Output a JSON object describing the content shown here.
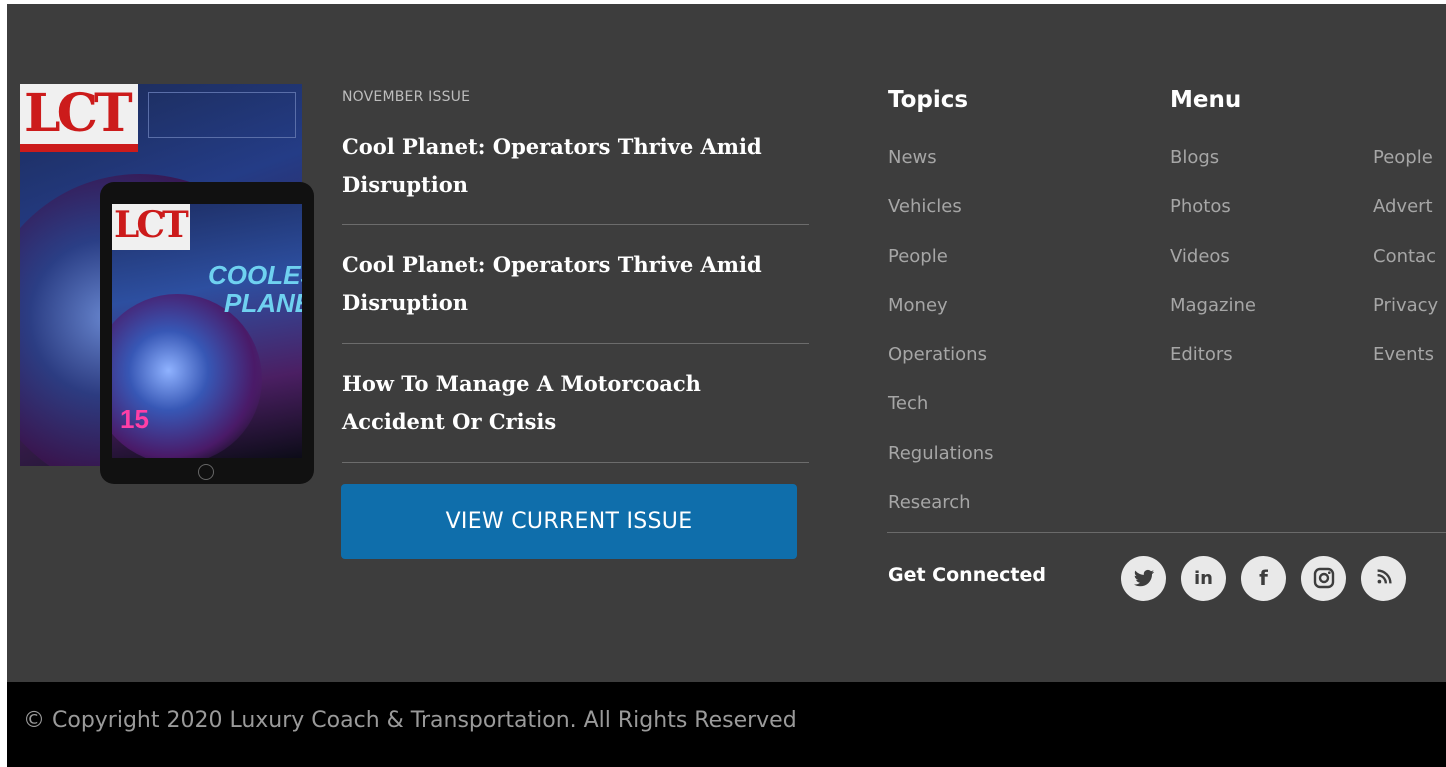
{
  "issue": {
    "label": "NOVEMBER ISSUE",
    "cover_logo": "LCT",
    "cover_headline_1": "COOLEST",
    "cover_headline_2": "PLANET",
    "cover_number": "15",
    "articles": [
      {
        "title": "Cool Planet: Operators Thrive Amid Disruption"
      },
      {
        "title": "Cool Planet: Operators Thrive Amid Disruption"
      },
      {
        "title": "How To Manage A Motorcoach Accident Or Crisis"
      }
    ],
    "view_button": "VIEW CURRENT ISSUE"
  },
  "topics": {
    "title": "Topics",
    "items": [
      "News",
      "Vehicles",
      "People",
      "Money",
      "Operations",
      "Tech",
      "Regulations",
      "Research"
    ]
  },
  "menu": {
    "title": "Menu",
    "col1": [
      "Blogs",
      "Photos",
      "Videos",
      "Magazine",
      "Editors"
    ],
    "col2": [
      "People",
      "Advert",
      "Contac",
      "Privacy",
      "Events"
    ]
  },
  "connect": {
    "title": "Get Connected",
    "icons": [
      "twitter-icon",
      "linkedin-icon",
      "facebook-icon",
      "instagram-icon",
      "rss-icon"
    ],
    "linkedin_glyph": "in",
    "facebook_glyph": "f"
  },
  "footer": {
    "copyright": "© Copyright 2020 Luxury Coach & Transportation. All Rights Reserved"
  },
  "colors": {
    "background": "#3d3d3d",
    "bottom_bar": "#000000",
    "button": "#0f6eab",
    "link": "#a6a6a6"
  }
}
